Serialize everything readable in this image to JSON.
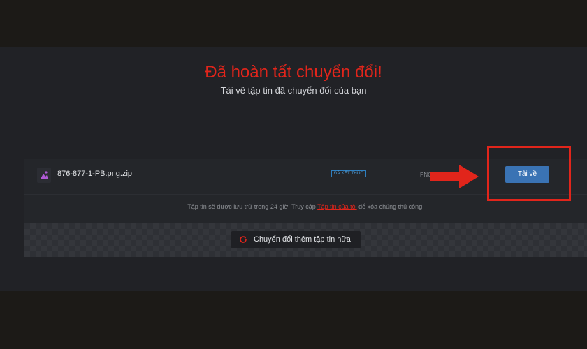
{
  "header": {
    "title": "Đã hoàn tất chuyển đổi!",
    "subtitle": "Tải về tập tin đã chuyển đổi của bạn"
  },
  "file": {
    "name": "876-877-1-PB.png.zip",
    "status": "ĐÃ KẾT THÚC",
    "format": "PNG",
    "download_label": "Tải về",
    "icon": "image-file-icon"
  },
  "info": {
    "text_before": "Tập tin sẽ được lưu trữ trong 24 giờ. Truy cập ",
    "link": "Tập tin của tôi",
    "text_after": " để xóa chúng thủ công."
  },
  "actions": {
    "convert_more_label": "Chuyển đổi thêm tập tin nữa",
    "convert_more_icon": "refresh-icon"
  },
  "colors": {
    "accent_red": "#e1251b",
    "button_blue": "#3a73b4",
    "badge_blue": "#2f7fbf",
    "background": "#212226"
  }
}
